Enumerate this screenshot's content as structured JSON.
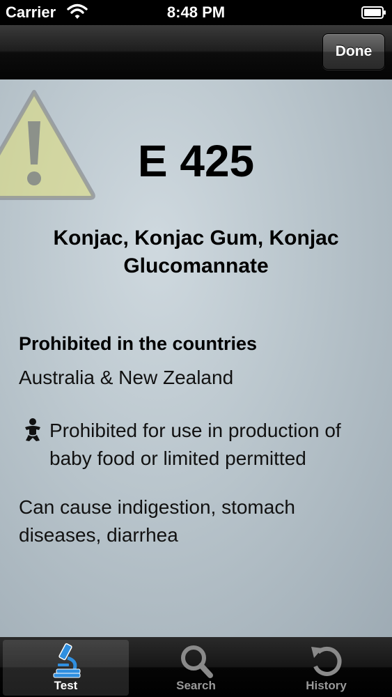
{
  "status_bar": {
    "carrier": "Carrier",
    "time": "8:48 PM"
  },
  "nav_bar": {
    "done_label": "Done"
  },
  "additive": {
    "code": "E 425",
    "name": "Konjac, Konjac Gum, Konjac Glucomannate",
    "prohibited_heading": "Prohibited in the countries",
    "prohibited_countries": "Australia & New Zealand",
    "baby_food_note": "Prohibited for use in production of baby food or limited permitted",
    "health_effects": "Can cause indigestion, stomach diseases, diarrhea"
  },
  "icons": {
    "warning": "warning-icon",
    "baby": "baby-icon",
    "test_tab": "microscope-icon",
    "search_tab": "magnifier-icon",
    "history_tab": "history-arrow-icon"
  },
  "colors": {
    "accent": "#2f8fe0",
    "warning_fill": "#e2e07a"
  },
  "tab_bar": {
    "tabs": [
      {
        "label": "Test",
        "active": true
      },
      {
        "label": "Search",
        "active": false
      },
      {
        "label": "History",
        "active": false
      }
    ]
  }
}
